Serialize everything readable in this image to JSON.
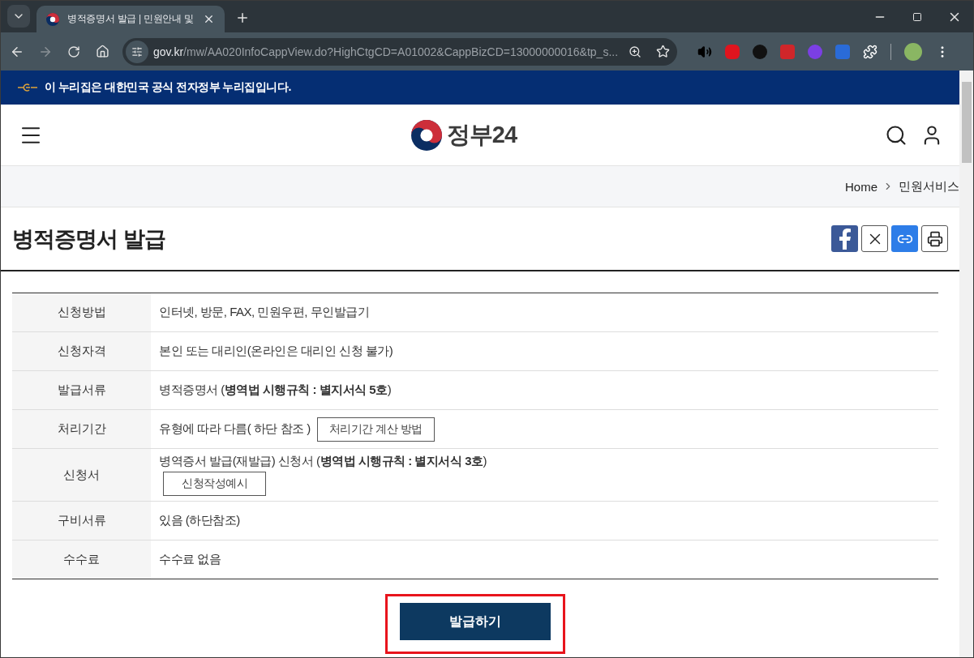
{
  "browser": {
    "tab_title": "병적증명서 발급 | 민원안내 및",
    "url_host": "gov.kr",
    "url_path": "/mw/AA020InfoCappView.do?HighCtgCD=A01002&CappBizCD=13000000016&tp_s..."
  },
  "banner": {
    "text": "이 누리집은 대한민국 공식 전자정부 누리집입니다."
  },
  "header": {
    "logo_text": "정부24"
  },
  "breadcrumb": [
    "Home",
    "민원서비스"
  ],
  "page_title": "병적증명서 발급",
  "info_rows": [
    {
      "kind": "plain",
      "label": "신청방법",
      "value": "인터넷, 방문, FAX, 민원우편, 무인발급기"
    },
    {
      "kind": "plain",
      "label": "신청자격",
      "value": "본인 또는 대리인(온라인은 대리인 신청 불가)"
    },
    {
      "kind": "plain",
      "label": "발급서류",
      "value": "병적증명서 (**병역법 시행규칙 : 별지서식 5호**)"
    },
    {
      "kind": "inline_button",
      "label": "처리기간",
      "value": "유형에 따라 다름( 하단 참조 )",
      "button": "처리기간 계산 방법"
    },
    {
      "kind": "button_below",
      "label": "신청서",
      "value": "병역증서 발급(재발급) 신청서 (**병역법 시행규칙 : 별지서식 3호**)",
      "button": "신청작성예시"
    },
    {
      "kind": "plain",
      "label": "구비서류",
      "value": "있음 (하단참조)"
    },
    {
      "kind": "plain",
      "label": "수수료",
      "value": "수수료 없음"
    }
  ],
  "submit": {
    "label": "발급하기",
    "highlighted": true
  }
}
